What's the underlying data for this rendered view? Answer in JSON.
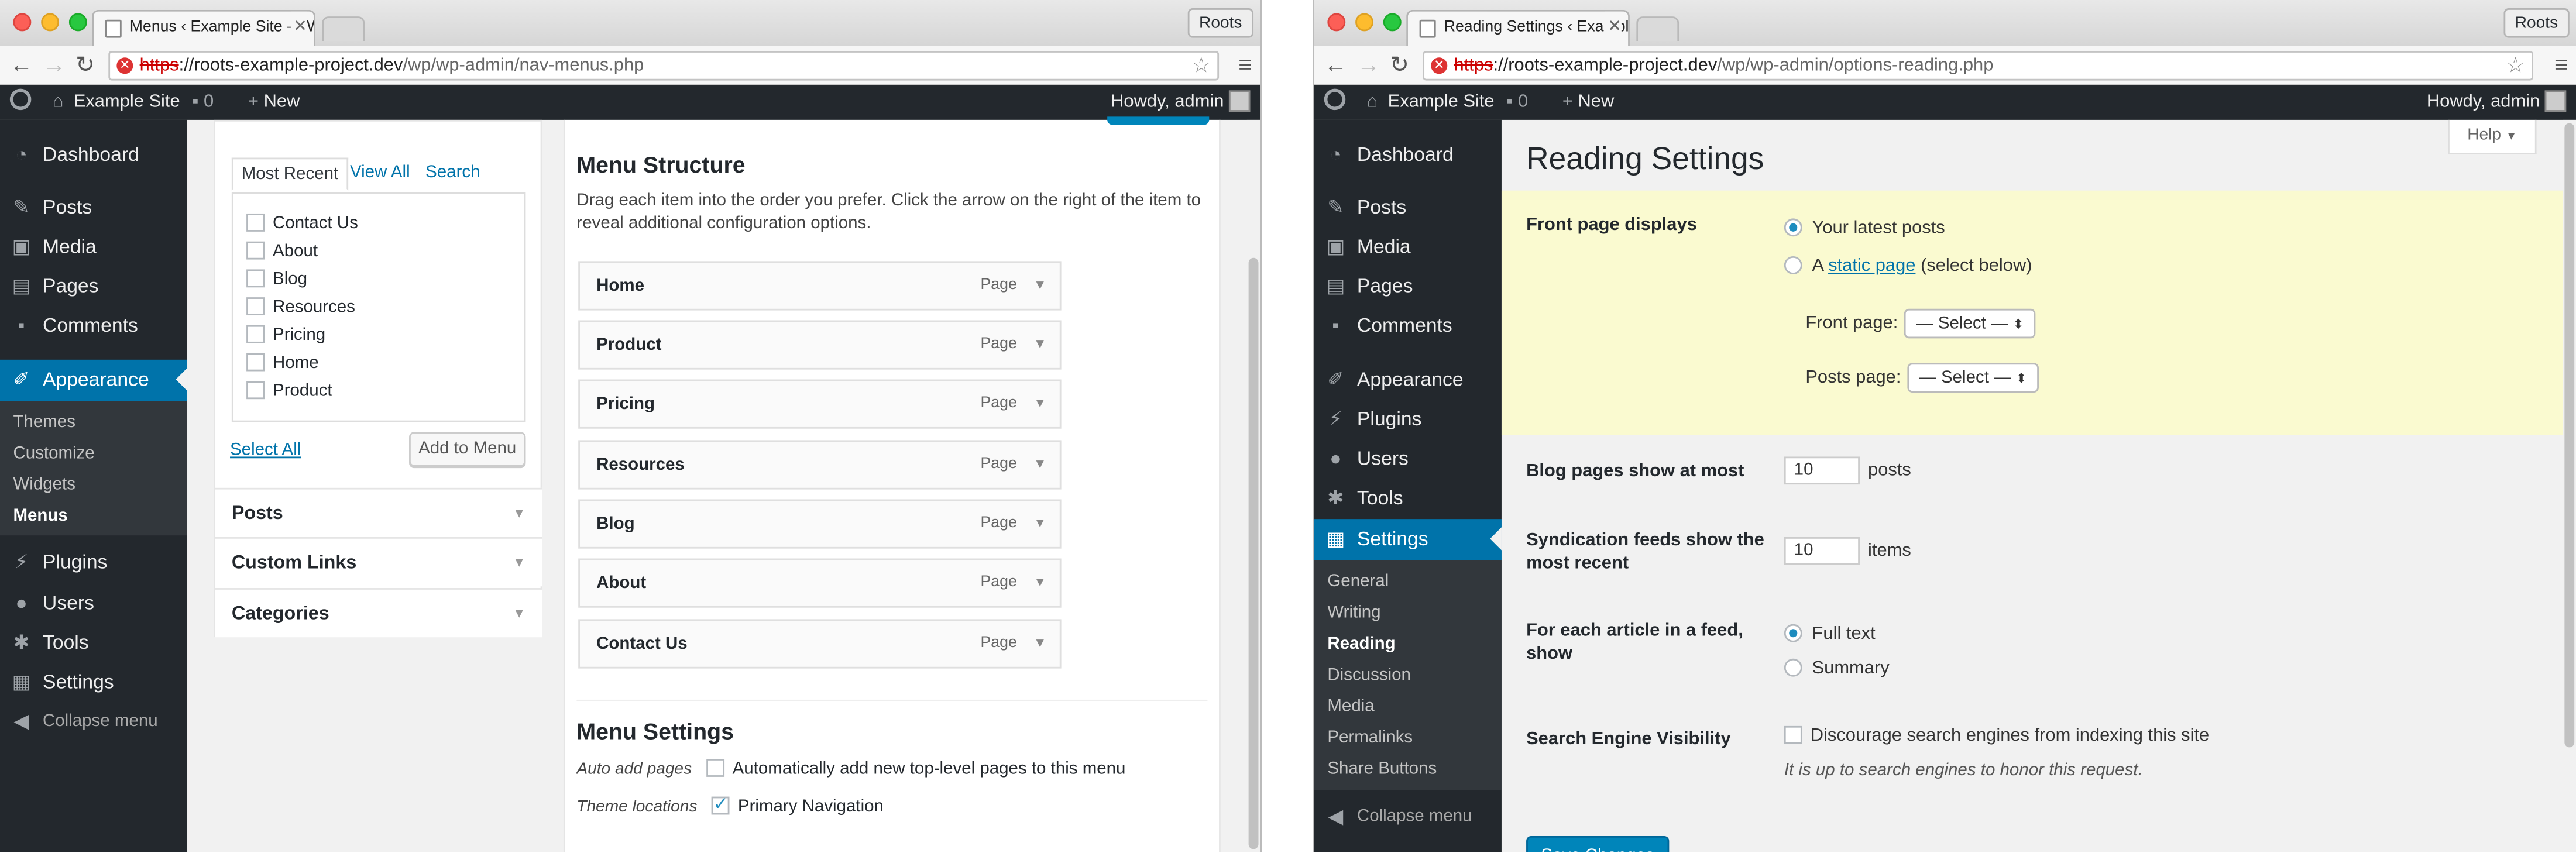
{
  "left": {
    "tab_title": "Menus ‹ Example Site — W",
    "profile": "Roots",
    "url_scheme": "https",
    "url_host": "://roots-example-project.dev",
    "url_path": "/wp/wp-admin/nav-menus.php",
    "adminbar": {
      "site": "Example Site",
      "comments": "0",
      "new": "New",
      "howdy": "Howdy, admin"
    },
    "sidebar": {
      "items": [
        "Dashboard",
        "Posts",
        "Media",
        "Pages",
        "Comments",
        "Appearance",
        "Plugins",
        "Users",
        "Tools",
        "Settings"
      ],
      "submenu": [
        "Themes",
        "Customize",
        "Widgets",
        "Menus"
      ],
      "collapse": "Collapse menu"
    },
    "pages_box": {
      "tabs": [
        "Most Recent",
        "View All",
        "Search"
      ],
      "items": [
        "Contact Us",
        "About",
        "Blog",
        "Resources",
        "Pricing",
        "Home",
        "Product"
      ],
      "select_all": "Select All",
      "add_to_menu": "Add to Menu"
    },
    "accordions": [
      "Posts",
      "Custom Links",
      "Categories"
    ],
    "menu_structure": {
      "title": "Menu Structure",
      "desc1": "Drag each item into the order you prefer. Click the arrow on the right of the item to",
      "desc2": "reveal additional configuration options.",
      "items": [
        {
          "label": "Home",
          "type": "Page"
        },
        {
          "label": "Product",
          "type": "Page"
        },
        {
          "label": "Pricing",
          "type": "Page"
        },
        {
          "label": "Resources",
          "type": "Page"
        },
        {
          "label": "Blog",
          "type": "Page"
        },
        {
          "label": "About",
          "type": "Page"
        },
        {
          "label": "Contact Us",
          "type": "Page"
        }
      ]
    },
    "menu_settings": {
      "title": "Menu Settings",
      "auto_add_label": "Auto add pages",
      "auto_add_text": "Automatically add new top-level pages to this menu",
      "theme_loc_label": "Theme locations",
      "theme_loc_text": "Primary Navigation"
    }
  },
  "right": {
    "tab_title": "Reading Settings ‹ Example",
    "profile": "Roots",
    "url_scheme": "https",
    "url_host": "://roots-example-project.dev",
    "url_path": "/wp/wp-admin/options-reading.php",
    "adminbar": {
      "site": "Example Site",
      "comments": "0",
      "new": "New",
      "howdy": "Howdy, admin"
    },
    "sidebar": {
      "items": [
        "Dashboard",
        "Posts",
        "Media",
        "Pages",
        "Comments",
        "Appearance",
        "Plugins",
        "Users",
        "Tools",
        "Settings"
      ],
      "submenu": [
        "General",
        "Writing",
        "Reading",
        "Discussion",
        "Media",
        "Permalinks",
        "Share Buttons"
      ],
      "collapse": "Collapse menu"
    },
    "help": "Help",
    "page_title": "Reading Settings",
    "front_page_displays": {
      "label": "Front page displays",
      "opt_latest": "Your latest posts",
      "opt_static_prefix": "A",
      "opt_static_link": "static page",
      "opt_static_suffix": "(select below)",
      "front_page_label": "Front page:",
      "posts_page_label": "Posts page:",
      "select_value": "— Select —"
    },
    "blog_pages": {
      "label": "Blog pages show at most",
      "value": "10",
      "unit": "posts"
    },
    "syndication": {
      "label1": "Syndication feeds show the",
      "label2": "most recent",
      "value": "10",
      "unit": "items"
    },
    "feed_article": {
      "label1": "For each article in a feed,",
      "label2": "show",
      "opt_full": "Full text",
      "opt_summary": "Summary"
    },
    "search_engine": {
      "label": "Search Engine Visibility",
      "checkbox": "Discourage search engines from indexing this site",
      "note": "It is up to search engines to honor this request."
    },
    "save": "Save Changes"
  }
}
